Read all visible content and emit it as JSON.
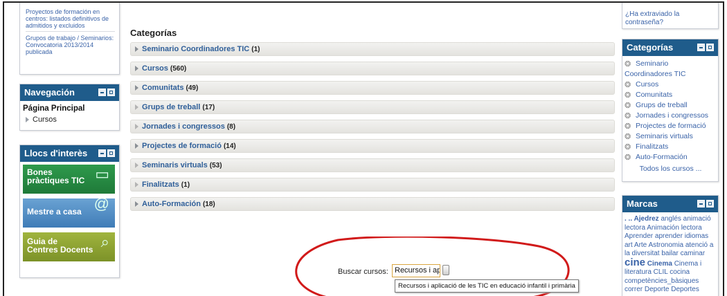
{
  "left": {
    "news": [
      "Proyectos de formación en centros: listados definitivos de admitidos y excluidos",
      "Grupos de trabajo / Seminarios: Convocatoria 2013/2014 publicada"
    ],
    "navigation": {
      "title": "Navegación",
      "home": "Página Principal",
      "sub": "Cursos"
    },
    "links": {
      "title": "Llocs d'interès",
      "banners": [
        {
          "line1": "Bones",
          "line2": "pràctiques TIC",
          "color": "#2e9a4c",
          "icon": "screen-icon"
        },
        {
          "line1": "Mestre a casa",
          "line2": "",
          "color": "#5a93c8",
          "icon": "m-at-icon"
        },
        {
          "line1": "Guia de",
          "line2": "Centres Docents",
          "color": "#94aa35",
          "icon": "magnifier-icon"
        }
      ]
    }
  },
  "main": {
    "title": "Categorías",
    "categories": [
      {
        "name": "Seminario Coordinadores TIC",
        "count": "(1)"
      },
      {
        "name": "Cursos",
        "count": "(560)"
      },
      {
        "name": "Comunitats",
        "count": "(49)"
      },
      {
        "name": "Grups de treball",
        "count": "(17)"
      },
      {
        "name": "Jornades i congressos",
        "count": "(8)"
      },
      {
        "name": "Projectes de formació",
        "count": "(14)"
      },
      {
        "name": "Seminaris virtuals",
        "count": "(53)"
      },
      {
        "name": "Finalitzats",
        "count": "(1)"
      },
      {
        "name": "Auto-Formación",
        "count": "(18)"
      }
    ],
    "search": {
      "label": "Buscar cursos:",
      "value": "Recursos i apl",
      "tooltip": "Recursos i aplicació de les TIC en educació infantil i primària",
      "annotation_color": "#d11a1a"
    }
  },
  "right": {
    "forgot": "¿Ha extraviado la contraseña?",
    "categories": {
      "title": "Categorías",
      "items": [
        "Seminario Coordinadores TIC",
        "Cursos",
        "Comunitats",
        "Grups de treball",
        "Jornades i congressos",
        "Projectes de formació",
        "Seminaris virtuals",
        "Finalitzats",
        "Auto-Formación"
      ],
      "all": "Todos los cursos ..."
    },
    "tags": {
      "title": "Marcas",
      "t1": ". .. Ajedrez",
      "t2": "anglés animació lectora Animación lectora Aprender aprender idiomas art Arte Astronomia atenció a la diversitat bailar caminar",
      "t3": "cine",
      "t4": "Cinema",
      "t5": "Cinema i literatura CLIL cocina competències_bàsiques correr Deporte Deportes"
    }
  }
}
